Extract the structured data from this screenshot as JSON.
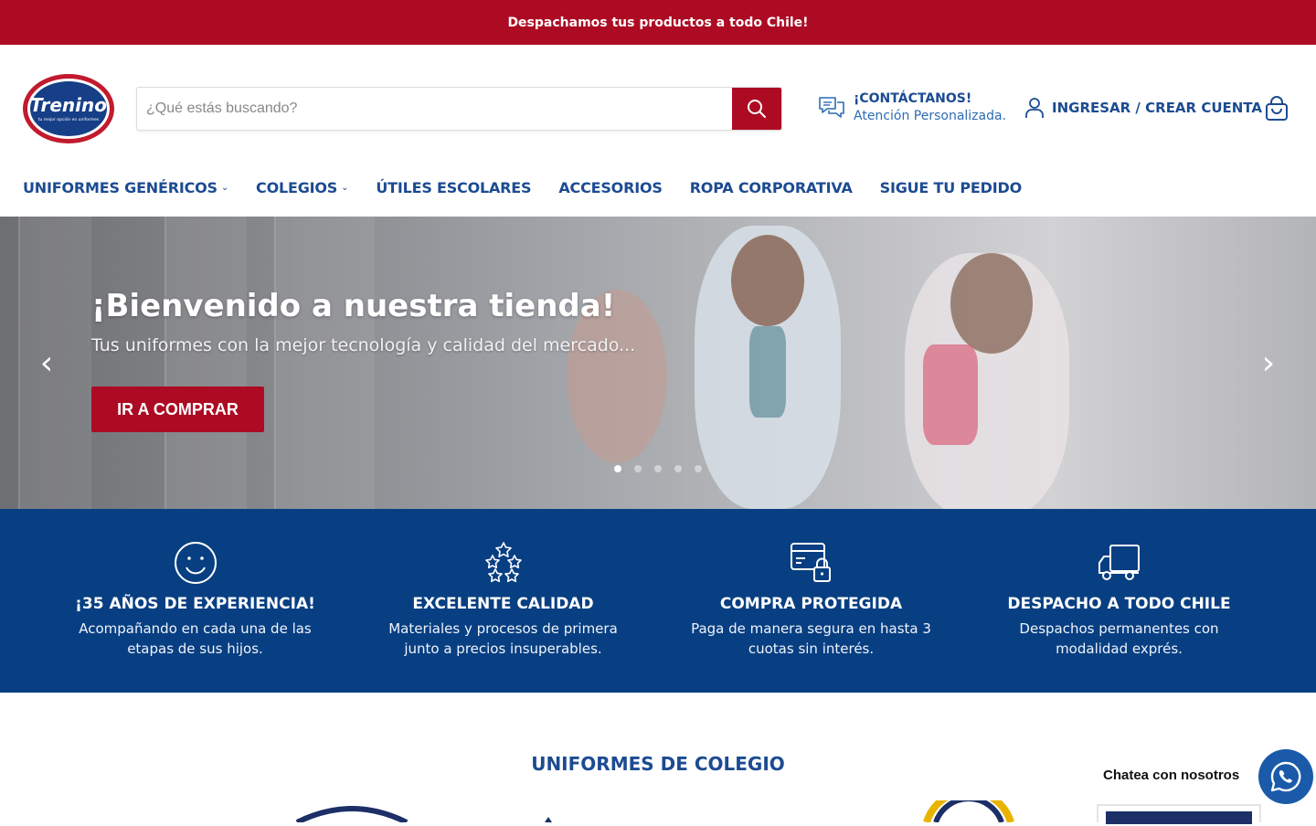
{
  "announcement": "Despachamos tus productos a todo Chile!",
  "brand": {
    "name": "Trenino",
    "tagline": "tu mejor opción en uniformes"
  },
  "search": {
    "placeholder": "¿Qué estás buscando?"
  },
  "contact": {
    "title": "¡CONTÁCTANOS!",
    "subtitle": "Atención Personalizada."
  },
  "account": {
    "label": "INGRESAR / CREAR CUENTA"
  },
  "nav": [
    {
      "label": "UNIFORMES GENÉRICOS",
      "dropdown": true
    },
    {
      "label": "COLEGIOS",
      "dropdown": true
    },
    {
      "label": "ÚTILES ESCOLARES",
      "dropdown": false
    },
    {
      "label": "ACCESORIOS",
      "dropdown": false
    },
    {
      "label": "ROPA CORPORATIVA",
      "dropdown": false
    },
    {
      "label": "SIGUE TU PEDIDO",
      "dropdown": false
    }
  ],
  "hero": {
    "title": "¡Bienvenido a nuestra tienda!",
    "subtitle": "Tus uniformes con la mejor tecnología y calidad del mercado...",
    "button": "IR A COMPRAR",
    "slide_count": 5,
    "active_slide": 1
  },
  "features": [
    {
      "icon": "smiley-icon",
      "title": "¡35 AÑOS DE EXPERIENCIA!",
      "text": "Acompañando en cada una de las etapas de sus hijos."
    },
    {
      "icon": "stars-icon",
      "title": "EXCELENTE CALIDAD",
      "text": "Materiales y procesos de primera junto a precios insuperables."
    },
    {
      "icon": "secure-card-icon",
      "title": "COMPRA PROTEGIDA",
      "text": "Paga de manera segura en hasta 3 cuotas sin interés."
    },
    {
      "icon": "delivery-truck-icon",
      "title": "DESPACHO A TODO CHILE",
      "text": "Despachos permanentes con modalidad exprés."
    }
  ],
  "section": {
    "title": "UNIFORMES DE COLEGIO"
  },
  "chat": {
    "label": "Chatea con nosotros"
  },
  "colors": {
    "brand_red": "#ad0b23",
    "brand_blue": "#083f82",
    "link_blue": "#1c4b92"
  }
}
